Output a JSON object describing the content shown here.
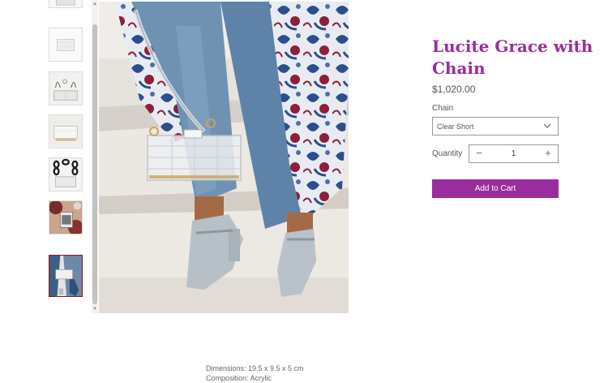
{
  "gallery": {
    "thumbnails": [
      {
        "name": "thumbnail-clear-bag-top"
      },
      {
        "name": "thumbnail-clear-bag-side"
      },
      {
        "name": "thumbnail-bag-with-gold-chain"
      },
      {
        "name": "thumbnail-bag-on-surface"
      },
      {
        "name": "thumbnail-bag-with-black-chain"
      },
      {
        "name": "thumbnail-bag-on-pattern"
      },
      {
        "name": "thumbnail-bag-lifestyle"
      }
    ],
    "selected_index": 6
  },
  "product": {
    "title": "Lucite Grace with Chain",
    "price": "$1,020.00",
    "chain_label": "Chain",
    "chain_selected": "Clear Short",
    "quantity_label": "Quantity",
    "quantity_value": "1",
    "quantity_minus": "−",
    "quantity_plus": "+",
    "add_to_cart": "Add to Cart"
  },
  "description": {
    "dimensions": "Dimensions: 19.5 x 9.5 x 5 cm",
    "composition": "Composition: Acrylic"
  },
  "colors": {
    "accent": "#9b2c9d",
    "selected_thumb_border": "#8b1a1a"
  },
  "icons": {
    "select_chevron": "chevron-down-icon",
    "scroll_up": "scroll-up-arrow-icon",
    "scroll_down": "scroll-down-arrow-icon"
  }
}
